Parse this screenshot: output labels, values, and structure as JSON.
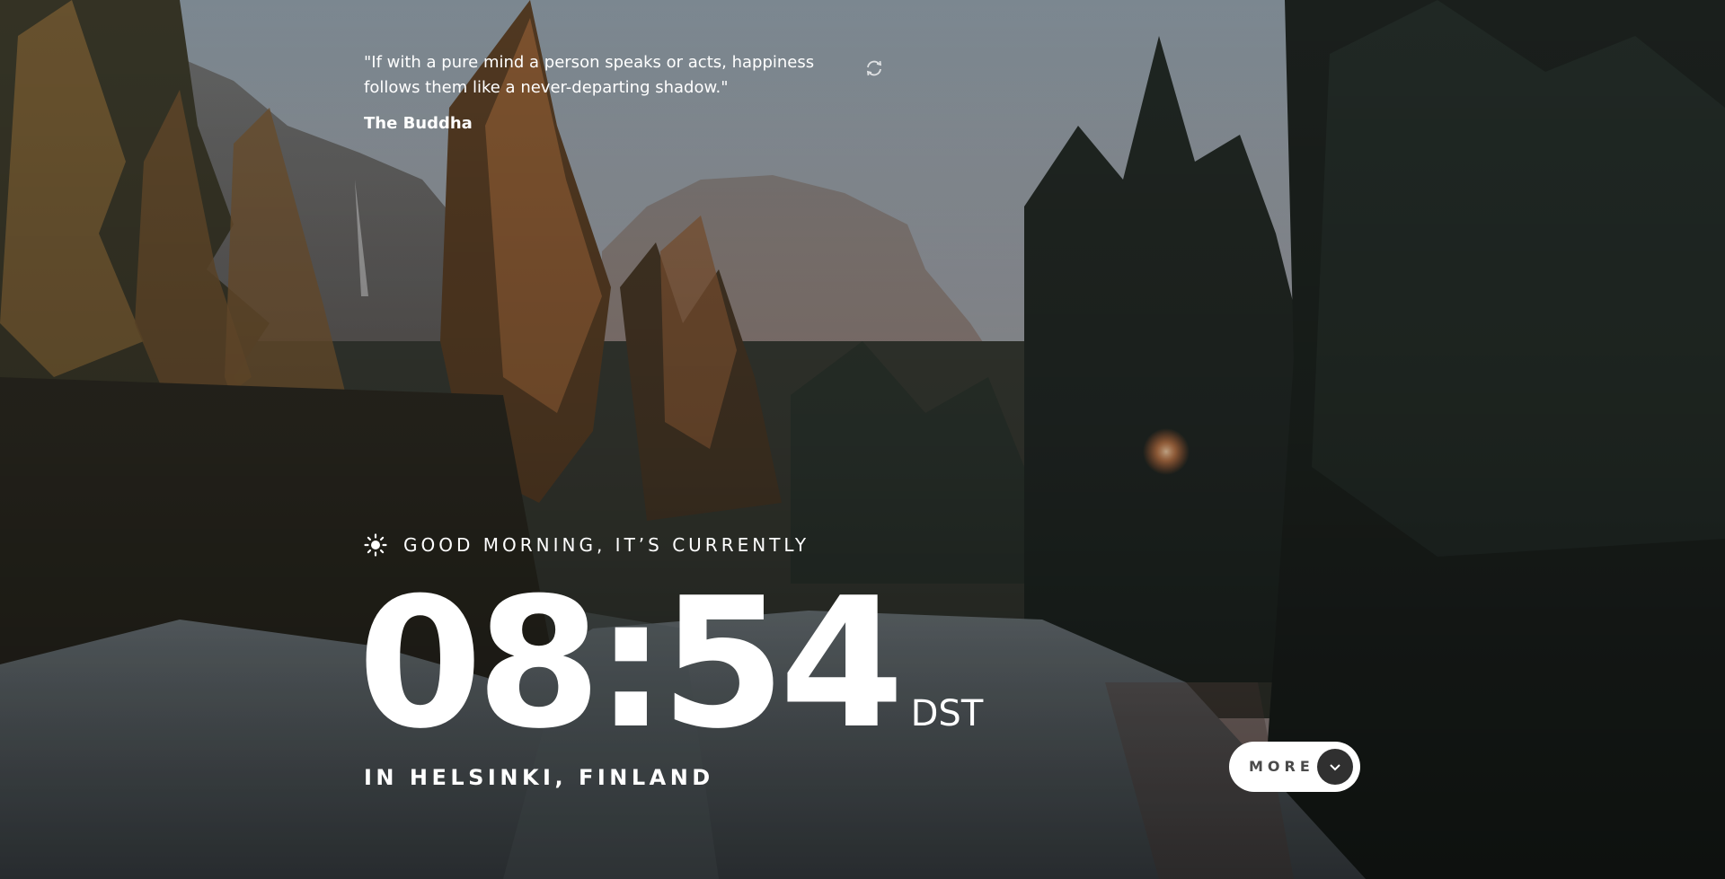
{
  "quote": {
    "text": "\"If with a pure mind a person speaks or acts, happiness follows them like a never-departing shadow.\"",
    "author": "The Buddha",
    "refresh_icon": "refresh-icon"
  },
  "greeting": {
    "icon": "sun-icon",
    "text": "GOOD MORNING, IT’S CURRENTLY"
  },
  "clock": {
    "time": "08:54",
    "timezone": "DST"
  },
  "location": {
    "text": "IN HELSINKI, FINLAND"
  },
  "more_button": {
    "label": "MORE",
    "icon": "chevron-down-icon"
  },
  "colors": {
    "text": "#FFFFFF",
    "button_bg": "#FFFFFF",
    "button_text": "#4A4A4A",
    "chevron_circle": "#303030"
  }
}
